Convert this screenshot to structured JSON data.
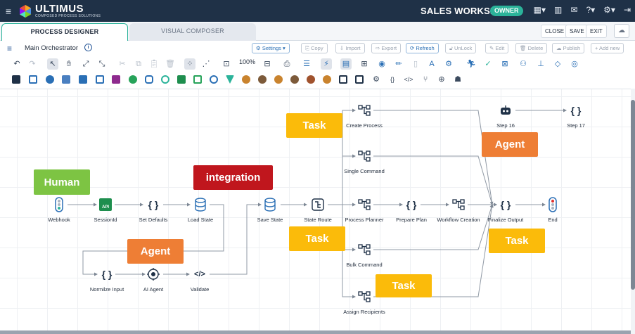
{
  "header": {
    "brand": "ULTIMUS",
    "brand_sub": "COMPOSED PROCESS SOLUTIONS",
    "workspace": "SALES WORKSPACE",
    "role_badge": "OWNER"
  },
  "tabs": [
    {
      "label": "PROCESS DESIGNER",
      "active": true
    },
    {
      "label": "VISUAL COMPOSER",
      "active": false
    }
  ],
  "window_actions": {
    "close": "CLOSE",
    "save": "SAVE",
    "exit": "EXIT"
  },
  "process": {
    "name": "Main Orchestrator"
  },
  "actions": {
    "settings": "Settings",
    "copy": "Copy",
    "import": "Import",
    "export": "Export",
    "refresh": "Refresh",
    "unlock": "UnLock",
    "edit": "Edit",
    "delete": "Delete",
    "publish": "Publish",
    "add_new": "+ Add new"
  },
  "zoom": "100%",
  "nodes": {
    "webhook": "Webhook",
    "session_id": "SessionId",
    "set_defaults": "Set Defaults",
    "load_state": "Load State",
    "save_state": "Save State",
    "state_route": "State Route",
    "create_process": "Create Process",
    "single_command": "Single Command",
    "process_planner": "Process Planner",
    "prepare_plan": "Prepare Plan",
    "workflow_creation": "Workflow Creation",
    "finalize_output": "Finalize Output",
    "end": "End",
    "bulk_command": "Bulk Command",
    "assign_recipients": "Assign Recipients",
    "step16": "Step 16",
    "step17": "Step 17",
    "normalize_input": "Normilze Input",
    "ai_agent": "AI Agent",
    "validate": "Validate",
    "api_badge": "API"
  },
  "stickies": {
    "human": {
      "text": "Human",
      "color": "#7dc443"
    },
    "integration": {
      "text": "integration",
      "color": "#c0161d"
    },
    "agent1": {
      "text": "Agent",
      "color": "#ee7e35"
    },
    "agent2": {
      "text": "Agent",
      "color": "#ee7e35"
    },
    "task1": {
      "text": "Task",
      "color": "#fbbb0a"
    },
    "task2": {
      "text": "Task",
      "color": "#fbbb0a"
    },
    "task3": {
      "text": "Task",
      "color": "#fbbb0a"
    },
    "task4": {
      "text": "Task",
      "color": "#fbbb0a"
    }
  }
}
